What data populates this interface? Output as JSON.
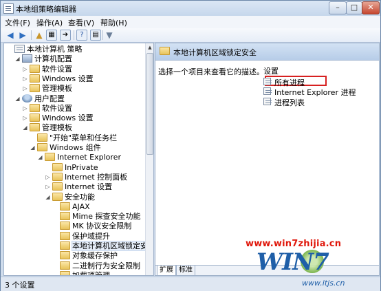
{
  "window": {
    "title": "本地组策略编辑器",
    "controls": [
      "–",
      "□",
      "✕"
    ]
  },
  "menu": [
    "文件(F)",
    "操作(A)",
    "查看(V)",
    "帮助(H)"
  ],
  "toolbar_icons": [
    "back-icon",
    "forward-icon",
    "up-folder-icon",
    "show-hide-tree-icon",
    "export-icon",
    "help-icon",
    "properties-icon",
    "filter-icon"
  ],
  "tree": [
    {
      "label": "本地计算机 策略",
      "icon": "policy",
      "exp": ""
    },
    {
      "label": "计算机配置",
      "icon": "computer",
      "exp": "◢"
    },
    {
      "label": "软件设置",
      "icon": "folder",
      "exp": "▷"
    },
    {
      "label": "Windows 设置",
      "icon": "folder",
      "exp": "▷"
    },
    {
      "label": "管理模板",
      "icon": "folder",
      "exp": "▷"
    },
    {
      "label": "用户配置",
      "icon": "user",
      "exp": "◢"
    },
    {
      "label": "软件设置",
      "icon": "folder",
      "exp": "▷"
    },
    {
      "label": "Windows 设置",
      "icon": "folder",
      "exp": "▷"
    },
    {
      "label": "管理模板",
      "icon": "folder",
      "exp": "◢"
    },
    {
      "label": "\"开始\"菜单和任务栏",
      "icon": "folder",
      "exp": ""
    },
    {
      "label": "Windows 组件",
      "icon": "folder",
      "exp": "◢"
    },
    {
      "label": "Internet Explorer",
      "icon": "folder",
      "exp": "◢"
    },
    {
      "label": "InPrivate",
      "icon": "folder",
      "exp": ""
    },
    {
      "label": "Internet 控制面板",
      "icon": "folder",
      "exp": "▷"
    },
    {
      "label": "Internet 设置",
      "icon": "folder",
      "exp": "▷"
    },
    {
      "label": "安全功能",
      "icon": "folder",
      "exp": "◢"
    },
    {
      "label": "AJAX",
      "icon": "folder",
      "exp": ""
    },
    {
      "label": "Mime 探查安全功能",
      "icon": "folder",
      "exp": ""
    },
    {
      "label": "MK 协议安全限制",
      "icon": "folder",
      "exp": ""
    },
    {
      "label": "保护域提升",
      "icon": "folder",
      "exp": ""
    },
    {
      "label": "本地计算机区域锁定安全",
      "icon": "folder",
      "exp": ""
    },
    {
      "label": "对象缓存保护",
      "icon": "folder",
      "exp": ""
    },
    {
      "label": "二进制行为安全限制",
      "icon": "folder",
      "exp": ""
    },
    {
      "label": "加载项管理",
      "icon": "folder",
      "exp": ""
    }
  ],
  "right": {
    "header": "本地计算机区域锁定安全",
    "description": "选择一个项目来查看它的描述。",
    "column": "设置",
    "items": [
      "所有进程",
      "Internet Explorer 进程",
      "进程列表"
    ]
  },
  "tabs": [
    "扩展",
    "标准"
  ],
  "status": "3 个设置",
  "watermark": {
    "url": "www.win7zhijia.cn",
    "logo": "WIN7",
    "sub": "www.itjs.cn"
  }
}
